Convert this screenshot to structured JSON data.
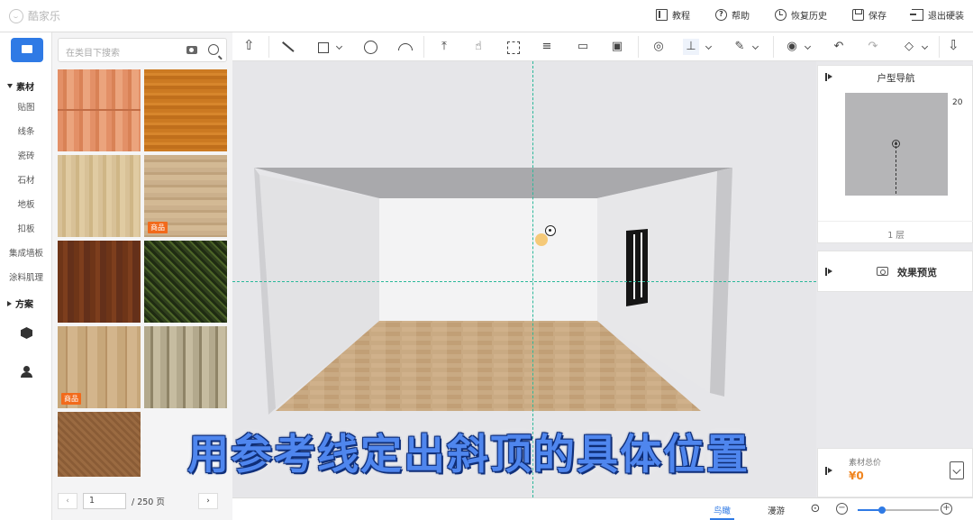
{
  "app": {
    "name": "酷家乐"
  },
  "topmenu": [
    {
      "label": "教程",
      "icon": "book-icon"
    },
    {
      "label": "帮助",
      "icon": "help-icon"
    },
    {
      "label": "恢复历史",
      "icon": "history-icon"
    },
    {
      "label": "保存",
      "icon": "save-icon"
    },
    {
      "label": "退出硬装",
      "icon": "exit-icon"
    }
  ],
  "rail": {
    "section_material": "素材",
    "items": [
      "贴图",
      "线条",
      "瓷砖",
      "石材",
      "地板",
      "扣板",
      "集成墙板",
      "涂料肌理"
    ],
    "section_plan": "方案"
  },
  "search": {
    "placeholder": "在类目下搜索"
  },
  "materials": [
    {
      "name": "wood-1",
      "badge": ""
    },
    {
      "name": "wood-2",
      "badge": ""
    },
    {
      "name": "wood-3",
      "badge": ""
    },
    {
      "name": "wood-4",
      "badge": "商品"
    },
    {
      "name": "wood-5",
      "badge": ""
    },
    {
      "name": "wood-6",
      "badge": ""
    },
    {
      "name": "wood-7",
      "badge": "商品"
    },
    {
      "name": "wood-8",
      "badge": ""
    },
    {
      "name": "wood-9",
      "badge": ""
    }
  ],
  "pager": {
    "current": "1",
    "total": "/ 250 页"
  },
  "nav": {
    "title": "户型导航",
    "scale_label": "20",
    "floor": "1 层"
  },
  "preview": {
    "label": "效果预览"
  },
  "cost": {
    "label": "素材总价",
    "value": "¥0"
  },
  "viewmodes": {
    "aerial": "鸟瞰",
    "roam": "漫游"
  },
  "zoom": {
    "level": 0.3
  },
  "subtitle": "用参考线定出斜顶的具体位置",
  "colors": {
    "accent": "#2f7ae5",
    "badge": "#f26a1b",
    "guide": "#2bb89a",
    "cost": "#f0841e"
  }
}
